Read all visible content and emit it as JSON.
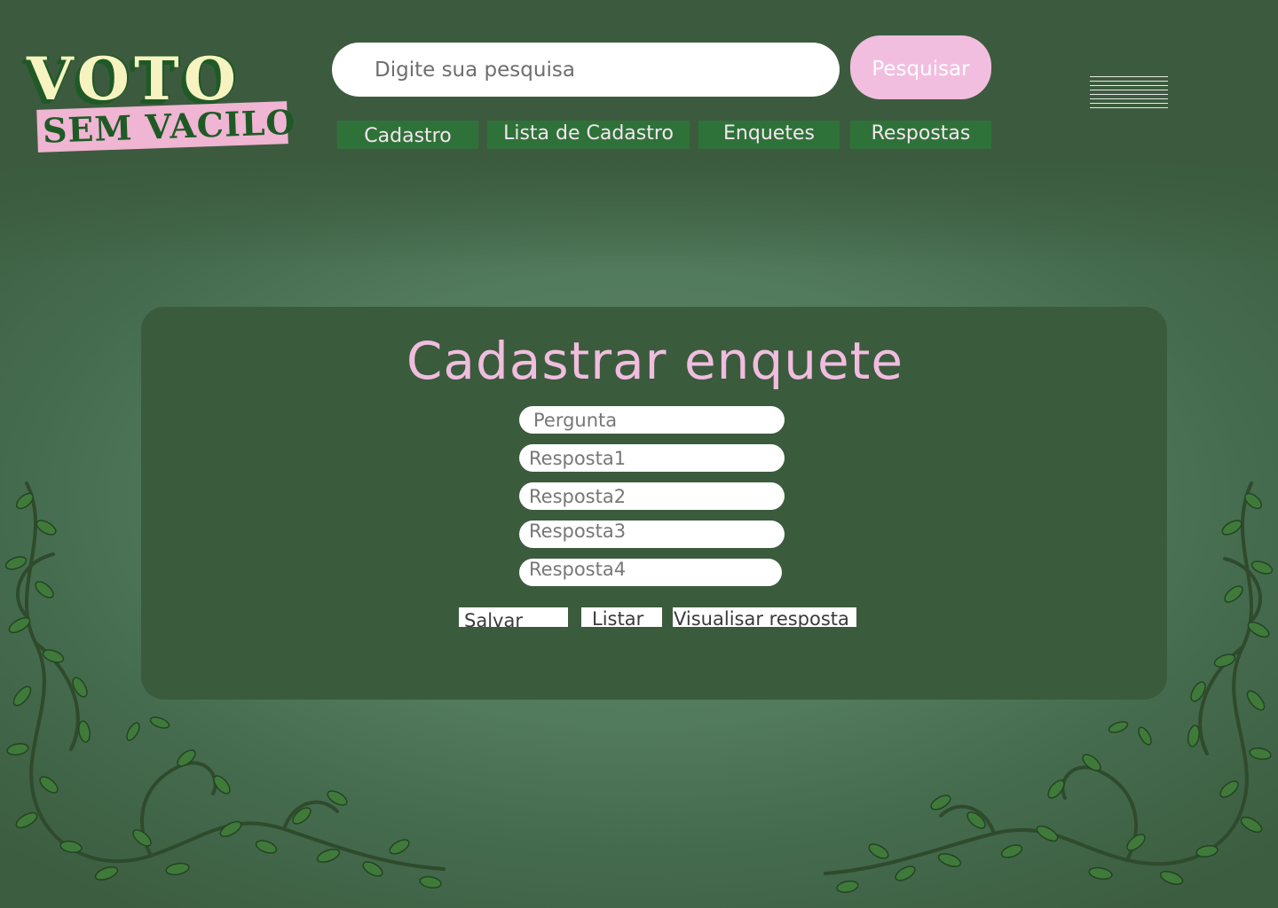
{
  "logo": {
    "line1": "VOTO",
    "line2": "SEM VACILO"
  },
  "search": {
    "placeholder": "Digite sua pesquisa",
    "button_label": "Pesquisar"
  },
  "nav": {
    "tabs": [
      {
        "label": "Cadastro"
      },
      {
        "label": "Lista de Cadastro"
      },
      {
        "label": "Enquetes"
      },
      {
        "label": "Respostas"
      }
    ],
    "menu_icon": "hamburger-menu-icon"
  },
  "form": {
    "title": "Cadastrar enquete",
    "fields": [
      {
        "placeholder": "Pergunta",
        "value": ""
      },
      {
        "placeholder": "Resposta1",
        "value": ""
      },
      {
        "placeholder": "Resposta2",
        "value": ""
      },
      {
        "placeholder": "Resposta3",
        "value": ""
      },
      {
        "placeholder": "Resposta4",
        "value": ""
      }
    ],
    "actions": {
      "save_label": "Salvar",
      "list_label": "Listar",
      "view_label": "Visualisar resposta"
    }
  },
  "colors": {
    "background": "#527a5c",
    "header": "#3c5b3e",
    "card": "#3b5b3d",
    "nav_tab": "#2f7239",
    "accent_pink": "#f0bddf",
    "logo_cream": "#f7f3c0",
    "logo_green": "#1f5a26"
  }
}
